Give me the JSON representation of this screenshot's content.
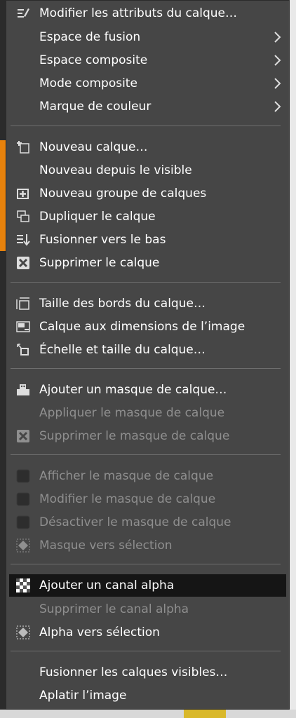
{
  "menu": {
    "items": [
      {
        "label": "Modifier les attributs du calque…",
        "icon": "edit-attributes-icon"
      },
      {
        "label": "Espace de fusion",
        "submenu": true
      },
      {
        "label": "Espace composite",
        "submenu": true
      },
      {
        "label": "Mode composite",
        "submenu": true
      },
      {
        "label": "Marque de couleur",
        "submenu": true
      },
      {
        "label": "Nouveau calque…",
        "icon": "new-layer-icon"
      },
      {
        "label": "Nouveau depuis le visible"
      },
      {
        "label": "Nouveau groupe de calques",
        "icon": "new-layer-group-icon"
      },
      {
        "label": "Dupliquer le calque",
        "icon": "duplicate-layer-icon"
      },
      {
        "label": "Fusionner vers le bas",
        "icon": "merge-down-icon"
      },
      {
        "label": "Supprimer le calque",
        "icon": "delete-layer-icon"
      },
      {
        "label": "Taille des bords du calque…",
        "icon": "layer-boundary-size-icon"
      },
      {
        "label": "Calque aux dimensions de l’image",
        "icon": "layer-to-image-size-icon"
      },
      {
        "label": "Échelle et taille du calque…",
        "icon": "scale-layer-icon"
      },
      {
        "label": "Ajouter un masque de calque…",
        "icon": "add-mask-icon"
      },
      {
        "label": "Appliquer le masque de calque",
        "disabled": true
      },
      {
        "label": "Supprimer le masque de calque",
        "disabled": true,
        "icon": "delete-mask-icon"
      },
      {
        "label": "Afficher le masque de calque",
        "disabled": true,
        "icon": "checkbox-icon"
      },
      {
        "label": "Modifier le masque de calque",
        "disabled": true,
        "icon": "checkbox-icon"
      },
      {
        "label": "Désactiver le masque de calque",
        "disabled": true,
        "icon": "checkbox-icon"
      },
      {
        "label": "Masque vers sélection",
        "disabled": true,
        "icon": "mask-to-selection-icon"
      },
      {
        "label": "Ajouter un canal alpha",
        "icon": "add-alpha-icon",
        "highlighted": true
      },
      {
        "label": "Supprimer le canal alpha",
        "disabled": true
      },
      {
        "label": "Alpha vers sélection",
        "icon": "alpha-to-selection-icon"
      },
      {
        "label": "Fusionner les calques visibles…"
      },
      {
        "label": "Aplatir l’image"
      }
    ]
  },
  "colors": {
    "menu_bg": "#464646",
    "highlight_bg": "#151515",
    "text": "#ffffff",
    "disabled_text": "#8f8f8f",
    "separator": "#6e6e6e"
  }
}
